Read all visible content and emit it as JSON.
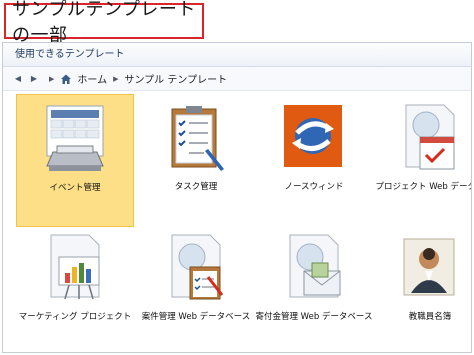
{
  "heading": "サンプルテンプレートの一部",
  "panel": {
    "header": "使用できるテンプレート",
    "breadcrumb": [
      "ホーム",
      "サンプル テンプレート"
    ]
  },
  "templates": [
    {
      "label": "イベント管理",
      "icon": "event-management-icon",
      "selected": true
    },
    {
      "label": "タスク管理",
      "icon": "task-management-icon",
      "selected": false
    },
    {
      "label": "ノースウィンド",
      "icon": "northwind-icon",
      "selected": false
    },
    {
      "label": "プロジェクト Web データベ",
      "icon": "project-web-database-icon",
      "selected": false
    },
    {
      "label": "マーケティング プロジェクト",
      "icon": "marketing-project-icon",
      "selected": false
    },
    {
      "label": "案件管理 Web データベース",
      "icon": "issues-web-database-icon",
      "selected": false
    },
    {
      "label": "寄付金管理 Web データベース",
      "icon": "charitable-contributions-web-database-icon",
      "selected": false
    },
    {
      "label": "教職員名簿",
      "icon": "faculty-icon",
      "selected": false
    }
  ],
  "colors": {
    "title_border": "#d9262a",
    "selection_fill": "#fcdf86",
    "northwind_orange": "#e05a12"
  }
}
